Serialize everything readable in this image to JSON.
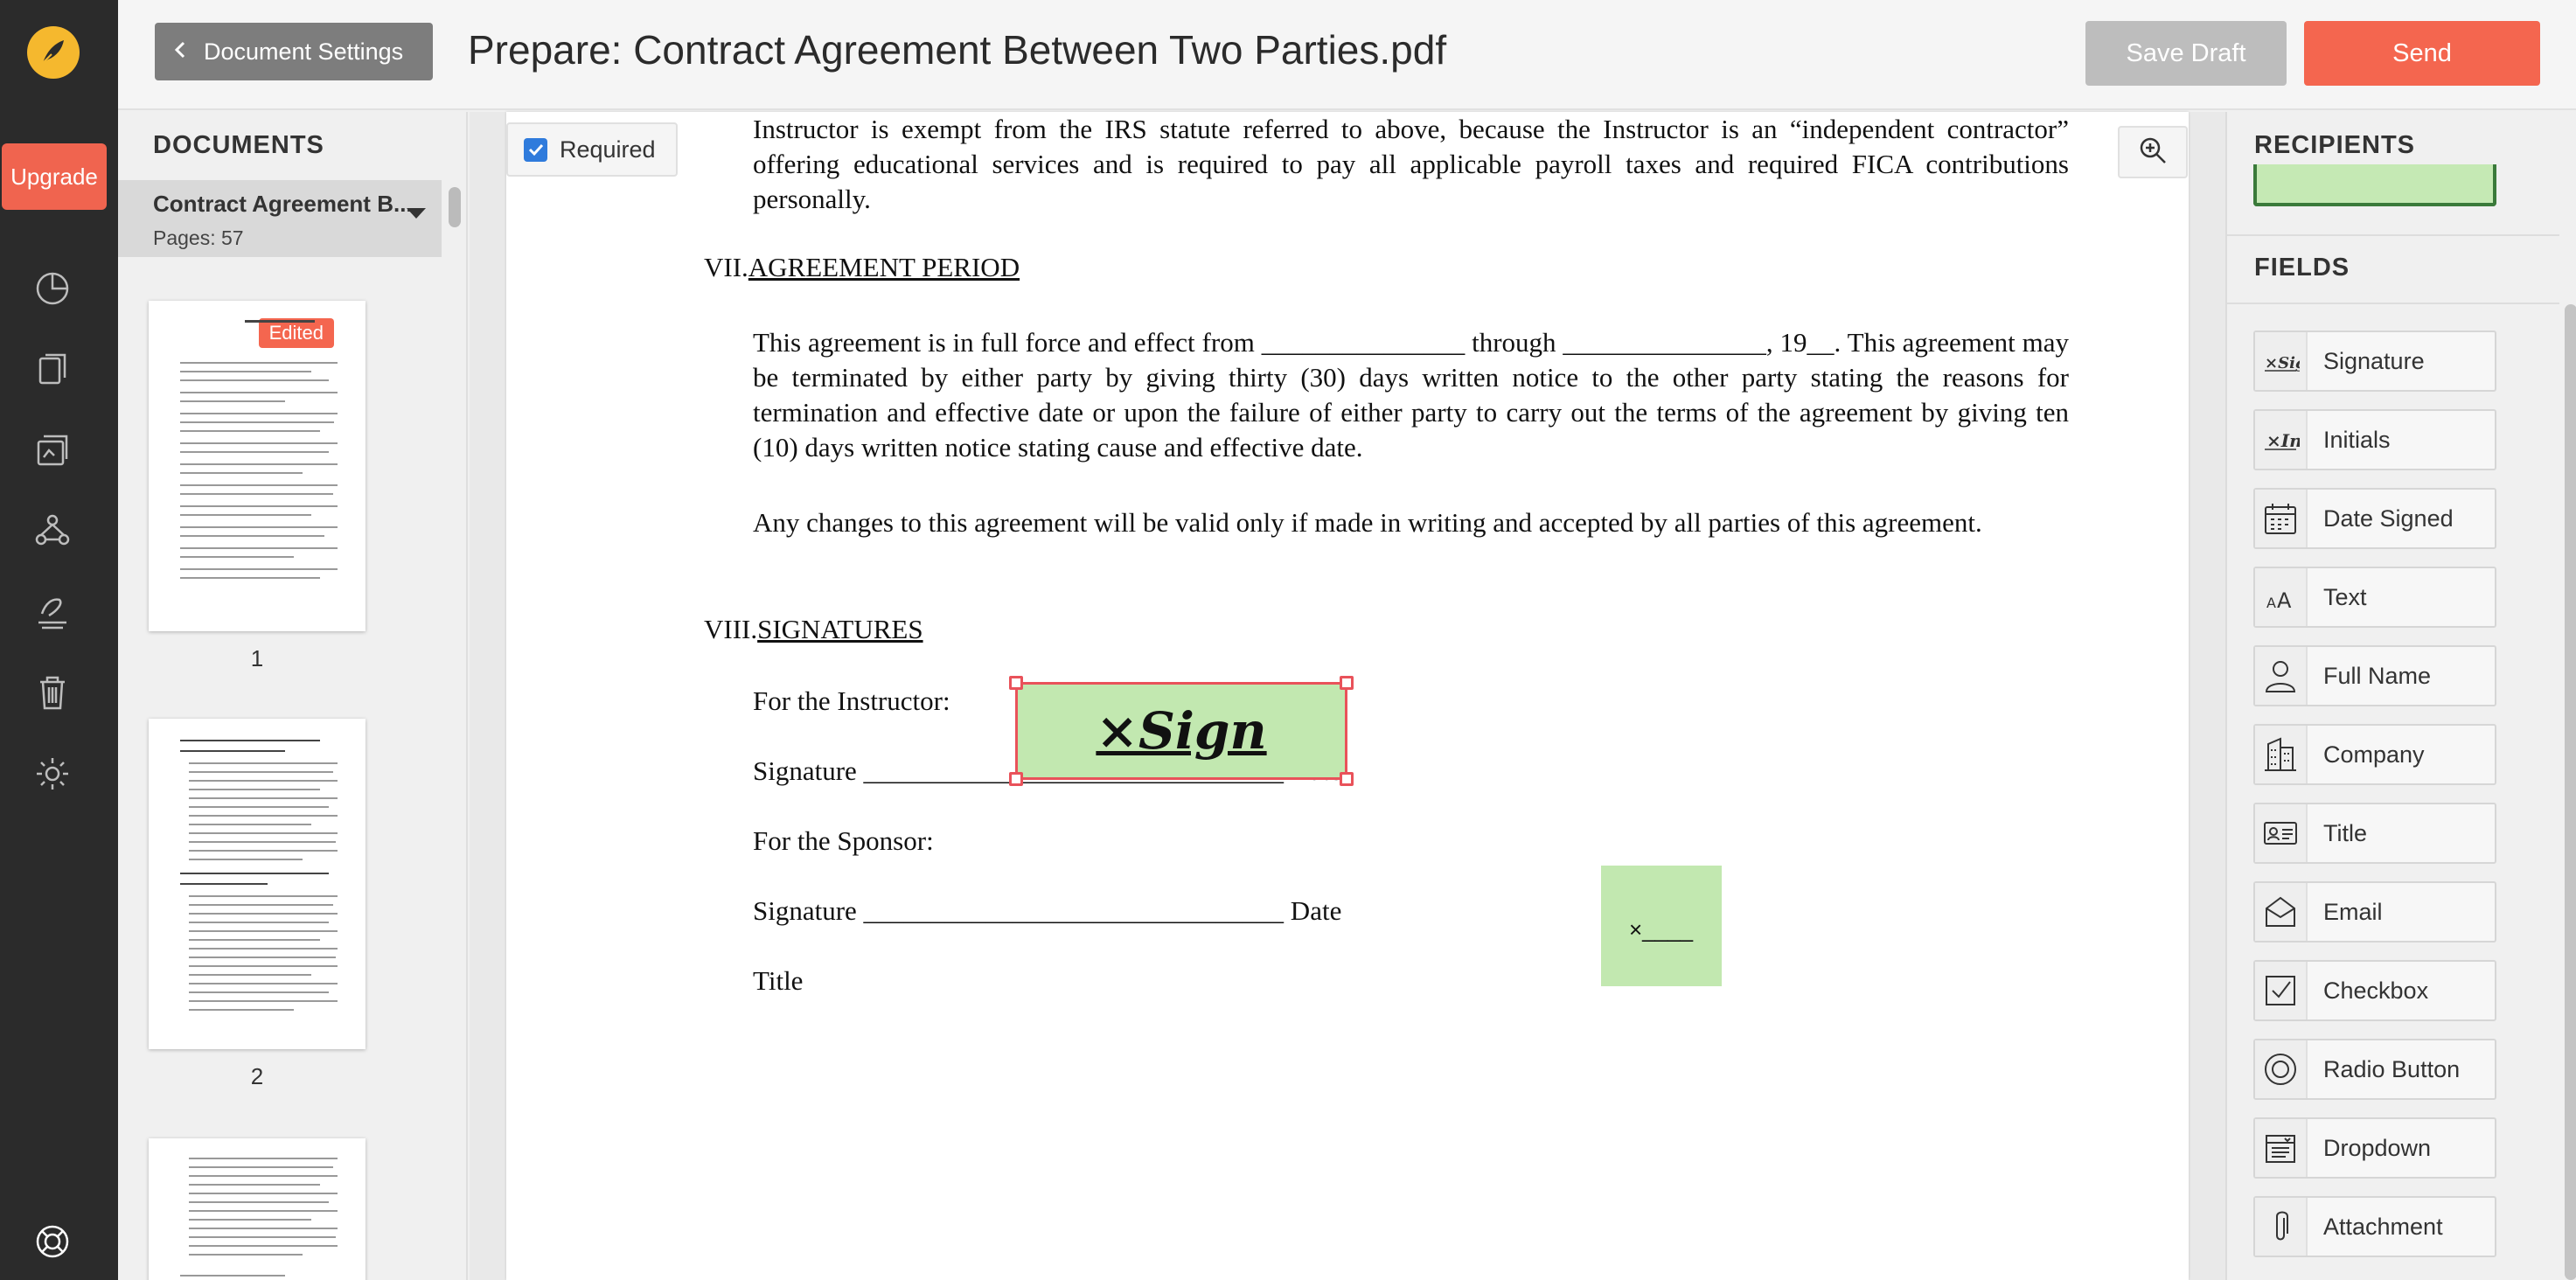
{
  "header": {
    "back_label": "Document Settings",
    "title": "Prepare: Contract Agreement Between Two Parties.pdf",
    "save_draft_label": "Save Draft",
    "send_label": "Send"
  },
  "rail": {
    "upgrade_label": "Upgrade"
  },
  "documents": {
    "heading": "DOCUMENTS",
    "current_name": "Contract Agreement B...",
    "current_pages": "Pages: 57",
    "edited_badge": "Edited",
    "thumbnails": [
      "1",
      "2"
    ]
  },
  "toolbar": {
    "required_label": "Required"
  },
  "document": {
    "para1": "Instructor is exempt from the IRS statute referred to above, because the Instructor is an “independent contractor” offering educational services and is required to pay all applicable payroll taxes and required FICA contributions personally.",
    "section7_num": "VII.",
    "section7_title": "AGREEMENT PERIOD",
    "para2": "This agreement is in full force and effect from _______________ through _______________, 19__.  This agreement may be terminated by either party by giving thirty (30) days written notice to the other party stating the reasons for termination and effective date or upon the failure of either party to carry out the terms of the agreement by giving ten (10) days written notice stating cause and effective date.",
    "para3": "Any changes to this agreement will be valid only if made in writing and accepted by all parties of this agreement.",
    "section8_num": "VIII.",
    "section8_title": "SIGNATURES",
    "for_instructor": "For the Instructor:",
    "signature_line": "Signature _______________________________ Date",
    "for_sponsor": "For the Sponsor:",
    "title_label": "Title",
    "sig_field_text": "×Sign",
    "init_field_text": "×____"
  },
  "right_panel": {
    "recipients_heading": "RECIPIENTS",
    "fields_heading": "FIELDS",
    "fields": [
      {
        "label": "Signature",
        "icon": "signature-icon"
      },
      {
        "label": "Initials",
        "icon": "initials-icon"
      },
      {
        "label": "Date Signed",
        "icon": "calendar-icon"
      },
      {
        "label": "Text",
        "icon": "text-icon"
      },
      {
        "label": "Full Name",
        "icon": "person-icon"
      },
      {
        "label": "Company",
        "icon": "building-icon"
      },
      {
        "label": "Title",
        "icon": "id-card-icon"
      },
      {
        "label": "Email",
        "icon": "envelope-icon"
      },
      {
        "label": "Checkbox",
        "icon": "checkbox-icon"
      },
      {
        "label": "Radio Button",
        "icon": "radio-icon"
      },
      {
        "label": "Dropdown",
        "icon": "dropdown-icon"
      },
      {
        "label": "Attachment",
        "icon": "paperclip-icon"
      }
    ]
  },
  "colors": {
    "accent": "#f4664f",
    "field_green": "#c2e8b0",
    "selection_red": "#e9525a",
    "rail_bg": "#2b2b2b"
  }
}
